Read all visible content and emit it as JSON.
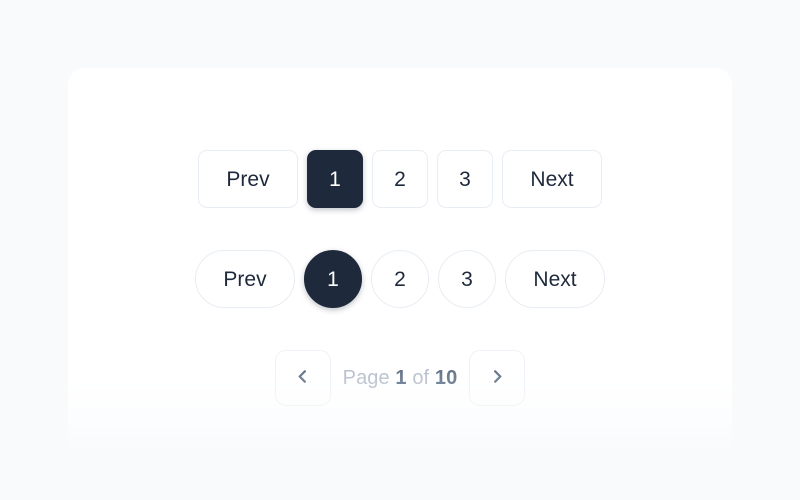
{
  "page": {
    "background_color": "#f8fafc",
    "card_color": "#ffffff"
  },
  "theme": {
    "active_bg": "#1e293b",
    "active_text": "#ffffff",
    "button_text": "#1e293b",
    "button_border": "#e8edf3",
    "muted_text": "#b7c0cd",
    "strong_text": "#64748b"
  },
  "pagination_squared": {
    "prev_label": "Prev",
    "next_label": "Next",
    "pages": [
      {
        "label": "1",
        "active": true
      },
      {
        "label": "2",
        "active": false
      },
      {
        "label": "3",
        "active": false
      }
    ]
  },
  "pagination_pill": {
    "prev_label": "Prev",
    "next_label": "Next",
    "pages": [
      {
        "label": "1",
        "active": true
      },
      {
        "label": "2",
        "active": false
      },
      {
        "label": "3",
        "active": false
      }
    ]
  },
  "pagination_compact": {
    "prev_icon": "chevron-left-icon",
    "next_icon": "chevron-right-icon",
    "status_prefix": "Page",
    "current_page": "1",
    "status_middle": "of",
    "total_pages": "10"
  }
}
